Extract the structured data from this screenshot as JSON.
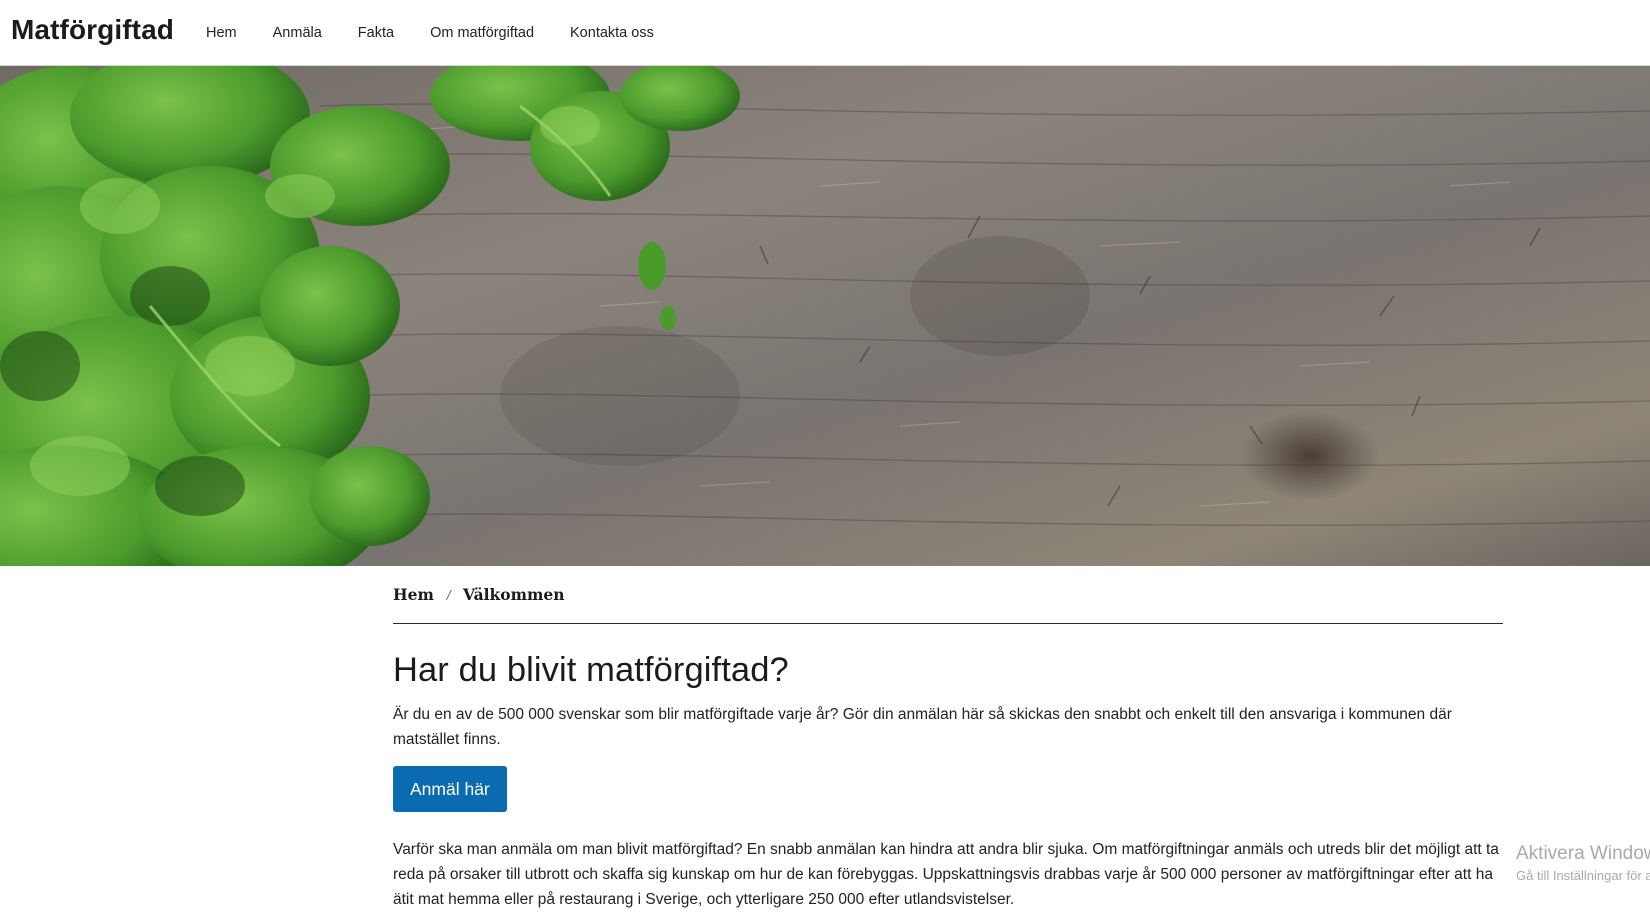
{
  "header": {
    "brand": "Matförgiftad",
    "nav": [
      {
        "label": "Hem"
      },
      {
        "label": "Anmäla"
      },
      {
        "label": "Fakta"
      },
      {
        "label": "Om matförgiftad"
      },
      {
        "label": "Kontakta oss"
      }
    ]
  },
  "hero": {
    "image": "parsley-on-wooden-board"
  },
  "breadcrumb": {
    "items": [
      {
        "label": "Hem"
      },
      {
        "label": "Välkommen"
      }
    ],
    "separator": "/"
  },
  "main": {
    "title": "Har du blivit matförgiftad?",
    "lead": "Är du en av de 500 000 svenskar som blir matförgiftade varje år? Gör din anmälan här så skickas den snabbt och enkelt till den ansvariga i kommunen där matstället finns.",
    "cta_label": "Anmäl här",
    "body": "Varför ska man anmäla om man blivit matförgiftad? En snabb anmälan kan hindra att andra blir sjuka. Om matförgiftningar anmäls och utreds blir det möjligt att ta reda på orsaker till utbrott och skaffa sig kunskap om hur de kan förebyggas. Uppskattningsvis drabbas varje år 500 000 personer av matförgiftningar efter att ha ätit mat hemma eller på restaurang i Sverige, och ytterligare 250 000 efter utlandsvistelser."
  },
  "watermark": {
    "line1": "Aktivera Windows",
    "line2": "Gå till Inställningar för att aktivera Windows."
  },
  "colors": {
    "button": "#0a6bb1",
    "text": "#1b1b1b",
    "wood": "#7b766f",
    "leaf": "#4e9a2c"
  }
}
